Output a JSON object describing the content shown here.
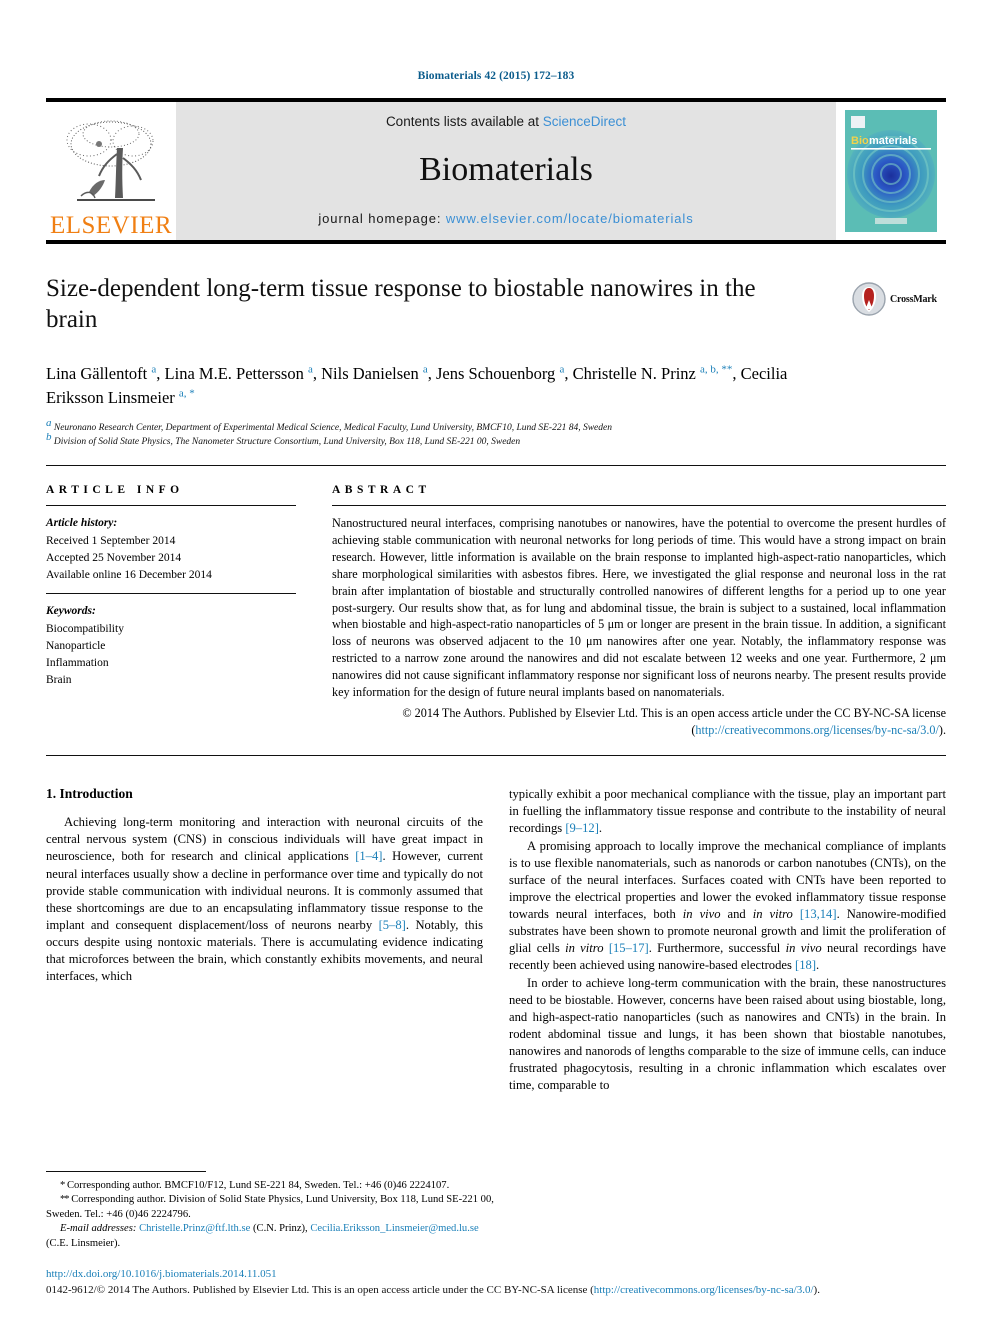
{
  "running_head": "Biomaterials 42 (2015) 172–183",
  "masthead": {
    "publisher_name": "ELSEVIER",
    "contents_prefix": "Contents lists available at ",
    "sciencedirect": "ScienceDirect",
    "journal_title": "Biomaterials",
    "homepage_prefix": "journal homepage: ",
    "homepage_url": "www.elsevier.com/locate/biomaterials",
    "cover_title_bio": "Bio",
    "cover_title_materials": "materials"
  },
  "article": {
    "title": "Size-dependent long-term tissue response to biostable nanowires in the brain",
    "crossmark_label": "CrossMark",
    "authors_html": "Lina Gällentoft <sup>a</sup>, Lina M.E. Pettersson <sup>a</sup>, Nils Danielsen <sup>a</sup>, Jens Schouenborg <sup>a</sup>, Christelle N. Prinz <sup>a, b, **</sup>, Cecilia Eriksson Linsmeier <sup>a, *</sup>",
    "affiliations": [
      "<sup>a</sup> Neuronano Research Center, Department of Experimental Medical Science, Medical Faculty, Lund University, BMCF10, Lund SE-221 84, Sweden",
      "<sup>b</sup> Division of Solid State Physics, The Nanometer Structure Consortium, Lund University, Box 118, Lund SE-221 00, Sweden"
    ]
  },
  "article_info": {
    "heading": "ARTICLE INFO",
    "history_label": "Article history:",
    "history": [
      "Received 1 September 2014",
      "Accepted 25 November 2014",
      "Available online 16 December 2014"
    ],
    "keywords_label": "Keywords:",
    "keywords": [
      "Biocompatibility",
      "Nanoparticle",
      "Inflammation",
      "Brain"
    ]
  },
  "abstract": {
    "heading": "ABSTRACT",
    "body": "Nanostructured neural interfaces, comprising nanotubes or nanowires, have the potential to overcome the present hurdles of achieving stable communication with neuronal networks for long periods of time. This would have a strong impact on brain research. However, little information is available on the brain response to implanted high-aspect-ratio nanoparticles, which share morphological similarities with asbestos fibres. Here, we investigated the glial response and neuronal loss in the rat brain after implantation of biostable and structurally controlled nanowires of different lengths for a period up to one year post-surgery. Our results show that, as for lung and abdominal tissue, the brain is subject to a sustained, local inflammation when biostable and high-aspect-ratio nanoparticles of 5 μm or longer are present in the brain tissue. In addition, a significant loss of neurons was observed adjacent to the 10 μm nanowires after one year. Notably, the inflammatory response was restricted to a narrow zone around the nanowires and did not escalate between 12 weeks and one year. Furthermore, 2 μm nanowires did not cause significant inflammatory response nor significant loss of neurons nearby. The present results provide key information for the design of future neural implants based on nanomaterials.",
    "copyright_prefix": "© 2014 The Authors. Published by Elsevier Ltd. This is an open access article under the CC BY-NC-SA license (",
    "copyright_link": "http://creativecommons.org/licenses/by-nc-sa/3.0/",
    "copyright_suffix": ")."
  },
  "introduction": {
    "heading": "1. Introduction",
    "left_paragraphs": [
      "Achieving long-term monitoring and interaction with neuronal circuits of the central nervous system (CNS) in conscious individuals will have great impact in neuroscience, both for research and clinical applications <span class=\"link\">[1–4]</span>. However, current neural interfaces usually show a decline in performance over time and typically do not provide stable communication with individual neurons. It is commonly assumed that these shortcomings are due to an encapsulating inflammatory tissue response to the implant and consequent displacement/loss of neurons nearby <span class=\"link\">[5–8]</span>. Notably, this occurs despite using nontoxic materials. There is accumulating evidence indicating that microforces between the brain, which constantly exhibits movements, and neural interfaces, which"
    ],
    "right_paragraphs": [
      "typically exhibit a poor mechanical compliance with the tissue, play an important part in fuelling the inflammatory tissue response and contribute to the instability of neural recordings <span class=\"link\">[9–12]</span>.",
      "A promising approach to locally improve the mechanical compliance of implants is to use flexible nanomaterials, such as nanorods or carbon nanotubes (CNTs), on the surface of the neural interfaces. Surfaces coated with CNTs have been reported to improve the electrical properties and lower the evoked inflammatory tissue response towards neural interfaces, both <i>in vivo</i> and <i>in vitro</i> <span class=\"link\">[13,14]</span>. Nanowire-modified substrates have been shown to promote neuronal growth and limit the proliferation of glial cells <i>in vitro</i> <span class=\"link\">[15–17]</span>. Furthermore, successful <i>in vivo</i> neural recordings have recently been achieved using nanowire-based electrodes <span class=\"link\">[18]</span>.",
      "In order to achieve long-term communication with the brain, these nanostructures need to be biostable. However, concerns have been raised about using biostable, long, and high-aspect-ratio nanoparticles (such as nanowires and CNTs) in the brain. In rodent abdominal tissue and lungs, it has been shown that biostable nanotubes, nanowires and nanorods of lengths comparable to the size of immune cells, can induce frustrated phagocytosis, resulting in a chronic inflammation which escalates over time, comparable to"
    ]
  },
  "footnotes": {
    "corresponding_1": "<span class=\"star\">*</span> Corresponding author. BMCF10/F12, Lund SE-221 84, Sweden. Tel.: +46 (0)46 2224107.",
    "corresponding_2": "<span class=\"star\">**</span> Corresponding author. Division of Solid State Physics, Lund University, Box 118, Lund SE-221 00, Sweden. Tel.: +46 (0)46 2224796.",
    "email_html": "<i>E-mail addresses:</i> <span class=\"link\">Christelle.Prinz@ftf.lth.se</span> (C.N. Prinz), <span class=\"link\">Cecilia.Eriksson_Linsmeier@med.lu.se</span> (C.E. Linsmeier)."
  },
  "page_footer": {
    "doi": "http://dx.doi.org/10.1016/j.biomaterials.2014.11.051",
    "issn_prefix": "0142-9612/© 2014 The Authors. Published by Elsevier Ltd. This is an open access article under the CC BY-NC-SA license (",
    "issn_link": "http://creativecommons.org/licenses/by-nc-sa/3.0/",
    "issn_suffix": ")."
  },
  "colors": {
    "link_blue": "#1a7fb8",
    "sciencedirect_blue": "#3b8fd4",
    "elsevier_orange": "#F07F13",
    "masthead_grey": "#e3e3e3",
    "running_head_blue": "#0b5c8c"
  }
}
